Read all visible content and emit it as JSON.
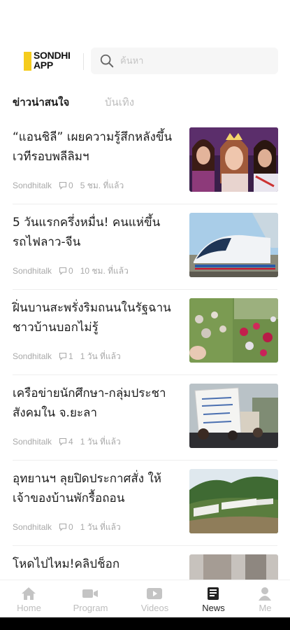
{
  "header": {
    "logo_line1": "SONDHI",
    "logo_line2": "APP",
    "search_placeholder": "ค้นหา",
    "accent_color": "#f5cc1d"
  },
  "tabs": [
    {
      "label": "ข่าวน่าสนใจ",
      "active": true
    },
    {
      "label": "บันเทิง",
      "active": false
    }
  ],
  "articles": [
    {
      "title": "“แอนชิลี” เผยความรู้สึกหลังขึ้นเวทีรอบพลีลิมฯ",
      "source": "Sondhitalk",
      "comments": "0",
      "time": "5 ชม. ที่แล้ว",
      "thumb": "pageant-photo"
    },
    {
      "title": "5 วันแรกครึ่งหมื่น! คนแห่ขึ้นรถไฟลาว-จีน",
      "source": "Sondhitalk",
      "comments": "0",
      "time": "10 ชม. ที่แล้ว",
      "thumb": "train-photo"
    },
    {
      "title": "ฝิ่นบานสะพรั่งริมถนนในรัฐฉาน ชาวบ้านบอกไม่รู้",
      "source": "Sondhitalk",
      "comments": "1",
      "time": "1 วัน ที่แล้ว",
      "thumb": "poppy-field-photo"
    },
    {
      "title": "เครือข่ายนักศึกษา-กลุ่มประชาสังคมใน จ.ยะลา",
      "source": "Sondhitalk",
      "comments": "4",
      "time": "1 วัน ที่แล้ว",
      "thumb": "protest-photo"
    },
    {
      "title": "อุทยานฯ ลุยปิดประกาศสั่ง ให้เจ้าของบ้านพักรื้อถอน",
      "source": "Sondhitalk",
      "comments": "0",
      "time": "1 วัน ที่แล้ว",
      "thumb": "resort-hillside-photo"
    },
    {
      "title": "โหดไปไหม!คลิปช็อก",
      "source": "",
      "comments": "",
      "time": "",
      "thumb": "partial-photo"
    }
  ],
  "bottom_nav": [
    {
      "label": "Home",
      "icon": "home-icon",
      "active": false
    },
    {
      "label": "Program",
      "icon": "video-camera-icon",
      "active": false
    },
    {
      "label": "Videos",
      "icon": "play-icon",
      "active": false
    },
    {
      "label": "News",
      "icon": "news-icon",
      "active": true
    },
    {
      "label": "Me",
      "icon": "person-icon",
      "active": false
    }
  ]
}
